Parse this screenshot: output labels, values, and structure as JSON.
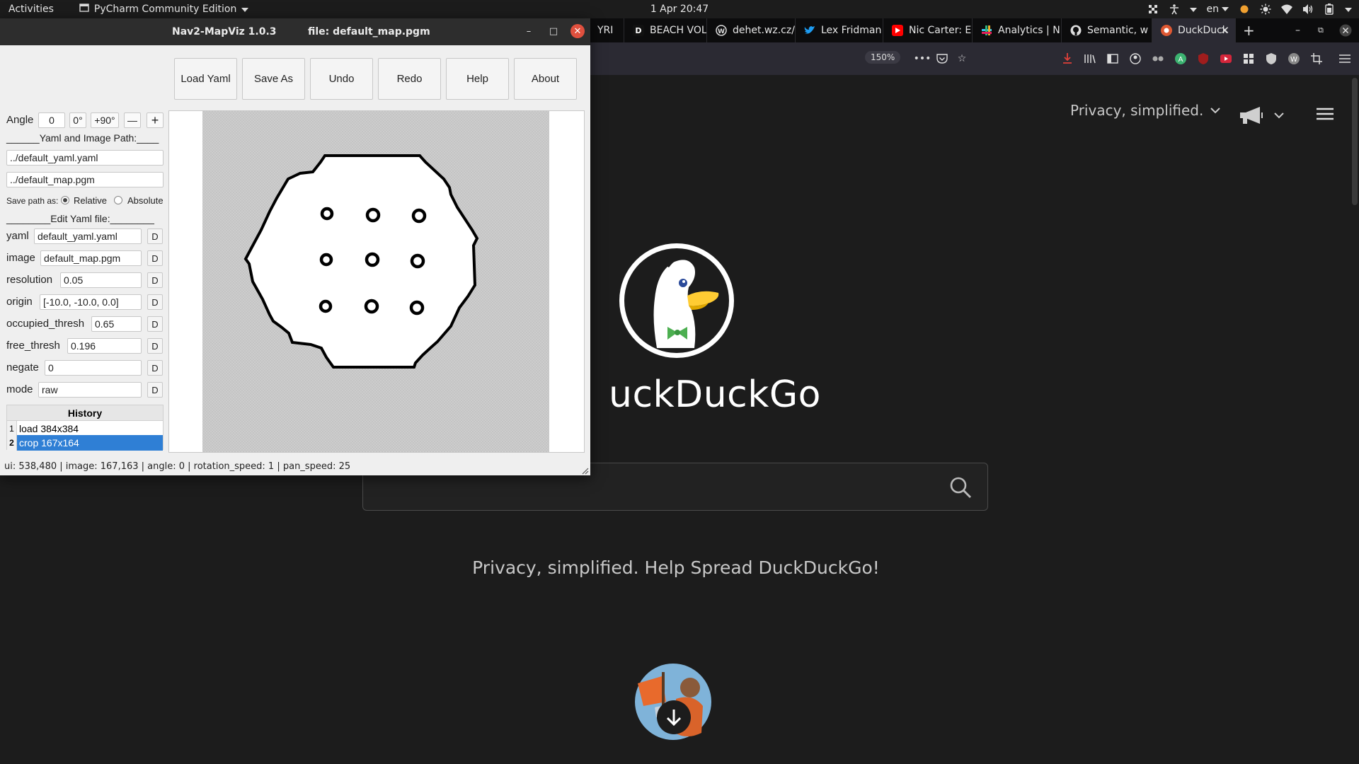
{
  "topbar": {
    "activities": "Activities",
    "app_name": "PyCharm Community Edition",
    "clock": "1 Apr  20:47",
    "language": "en"
  },
  "firefox": {
    "tabs": [
      {
        "label": "YRI",
        "favicon": "unknown"
      },
      {
        "label": "BEACH VOL",
        "favicon": "letter-d"
      },
      {
        "label": "dehet.wz.cz/",
        "favicon": "wordpress-icon"
      },
      {
        "label": "Lex Fridman",
        "favicon": "twitter-icon"
      },
      {
        "label": "Nic Carter: E",
        "favicon": "youtube-icon"
      },
      {
        "label": "Analytics | N",
        "favicon": "slack-icon"
      },
      {
        "label": "Semantic, w",
        "favicon": "github-icon"
      },
      {
        "label": "DuckDuck",
        "favicon": "duckduckgo-icon"
      }
    ],
    "zoom": "150%",
    "page": {
      "privacy_menu": "Privacy, simplified.",
      "wordmark": "uckDuckGo",
      "search_placeholder": "",
      "tagline": "Privacy, simplified. Help Spread DuckDuckGo!"
    }
  },
  "mapviz": {
    "title": "Nav2-MapViz 1.0.3",
    "file": "file: default_map.pgm",
    "buttons": [
      "Load Yaml",
      "Save As",
      "Undo",
      "Redo",
      "Help",
      "About"
    ],
    "angle_label": "Angle",
    "angle_value": "0",
    "angle_0": "0°",
    "angle_90": "+90°",
    "angle_minus": "—",
    "angle_plus": "+",
    "paths_header": "______Yaml and Image Path:____",
    "yaml_path": "../default_yaml.yaml",
    "image_path": "../default_map.pgm",
    "save_path_label": "Save path as:",
    "relative_label": "Relative",
    "absolute_label": "Absolute",
    "save_path_mode": "relative",
    "edit_header": "________Edit Yaml file:________",
    "fields": [
      {
        "label": "yaml",
        "value": "default_yaml.yaml"
      },
      {
        "label": "image",
        "value": "default_map.pgm"
      },
      {
        "label": "resolution",
        "value": "0.05"
      },
      {
        "label": "origin",
        "value": "[-10.0, -10.0, 0.0]"
      },
      {
        "label": "occupied_thresh",
        "value": "0.65"
      },
      {
        "label": "free_thresh",
        "value": "0.196"
      },
      {
        "label": "negate",
        "value": "0"
      },
      {
        "label": "mode",
        "value": "raw"
      }
    ],
    "d_label": "D",
    "history_header": "History",
    "history": [
      {
        "num": "1",
        "text": "load 384x384"
      },
      {
        "num": "2",
        "text": "crop 167x164"
      }
    ],
    "status": "ui: 538,480 | image: 167,163 | angle: 0 | rotation_speed: 1 | pan_speed: 25"
  },
  "colors": {
    "accent_selection": "#2f7fd5",
    "close_button": "#e0503e",
    "ddg_red": "#de5833",
    "ddg_background": "#1c1c1c"
  }
}
